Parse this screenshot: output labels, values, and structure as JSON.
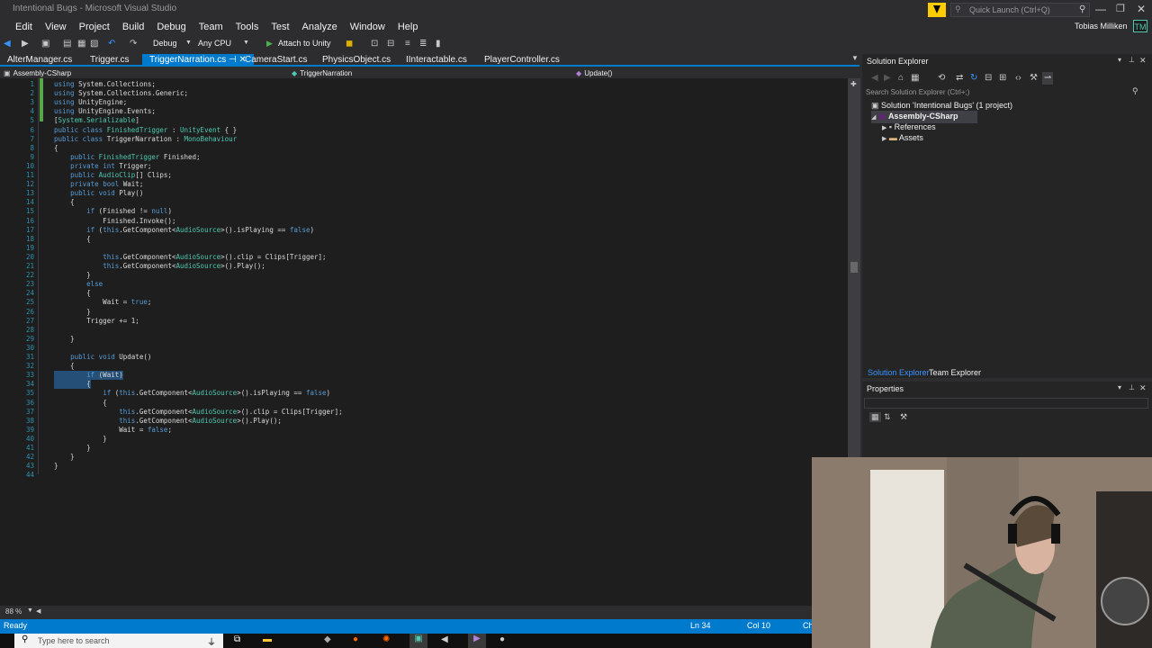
{
  "window": {
    "title": "Intentional Bugs - Microsoft Visual Studio",
    "quick_launch_placeholder": "Quick Launch (Ctrl+Q)",
    "user": "Tobias Milliken",
    "user_initials": "TM"
  },
  "menu": [
    "Edit",
    "View",
    "Project",
    "Build",
    "Debug",
    "Team",
    "Tools",
    "Test",
    "Analyze",
    "Window",
    "Help"
  ],
  "toolbar": {
    "config": "Debug",
    "platform": "Any CPU",
    "attach_label": "Attach to Unity"
  },
  "tabs": [
    {
      "label": "AlterManager.cs",
      "active": false
    },
    {
      "label": "Trigger.cs",
      "active": false
    },
    {
      "label": "TriggerNarration.cs",
      "active": true
    },
    {
      "label": "CameraStart.cs",
      "active": false
    },
    {
      "label": "PhysicsObject.cs",
      "active": false
    },
    {
      "label": "IInteractable.cs",
      "active": false
    },
    {
      "label": "PlayerController.cs",
      "active": false
    }
  ],
  "navbar": {
    "project": "Assembly-CSharp",
    "class": "TriggerNarration",
    "member": "Update()"
  },
  "code_lines": [
    "using System.Collections;",
    "using System.Collections.Generic;",
    "using UnityEngine;",
    "using UnityEngine.Events;",
    "[System.Serializable]",
    "public class FinishedTrigger : UnityEvent { }",
    "public class TriggerNarration : MonoBehaviour",
    "{",
    "    public FinishedTrigger Finished;",
    "    private int Trigger;",
    "    public AudioClip[] Clips;",
    "    private bool Wait;",
    "    public void Play()",
    "    {",
    "        if (Finished != null)",
    "            Finished.Invoke();",
    "        if (this.GetComponent<AudioSource>().isPlaying == false)",
    "        {",
    "",
    "            this.GetComponent<AudioSource>().clip = Clips[Trigger];",
    "            this.GetComponent<AudioSource>().Play();",
    "        }",
    "        else",
    "        {",
    "            Wait = true;",
    "        }",
    "        Trigger += 1;",
    "",
    "    }",
    "",
    "    public void Update()",
    "    {",
    "        if (Wait)",
    "        {",
    "            if (this.GetComponent<AudioSource>().isPlaying == false)",
    "            {",
    "                this.GetComponent<AudioSource>().clip = Clips[Trigger];",
    "                this.GetComponent<AudioSource>().Play();",
    "                Wait = false;",
    "            }",
    "        }",
    "    }",
    "}",
    ""
  ],
  "solution_explorer": {
    "title": "Solution Explorer",
    "search_placeholder": "Search Solution Explorer (Ctrl+;)",
    "solution": "Solution 'Intentional Bugs' (1 project)",
    "project": "Assembly-CSharp",
    "children": [
      "References",
      "Assets"
    ],
    "tabs": [
      "Solution Explorer",
      "Team Explorer"
    ]
  },
  "properties": {
    "title": "Properties"
  },
  "status": {
    "left": "Ready",
    "ln": "Ln 34",
    "col": "Col 10",
    "ch": "Ch"
  },
  "zoom": "88 %",
  "taskbar": {
    "search_placeholder": "Type here to search"
  }
}
